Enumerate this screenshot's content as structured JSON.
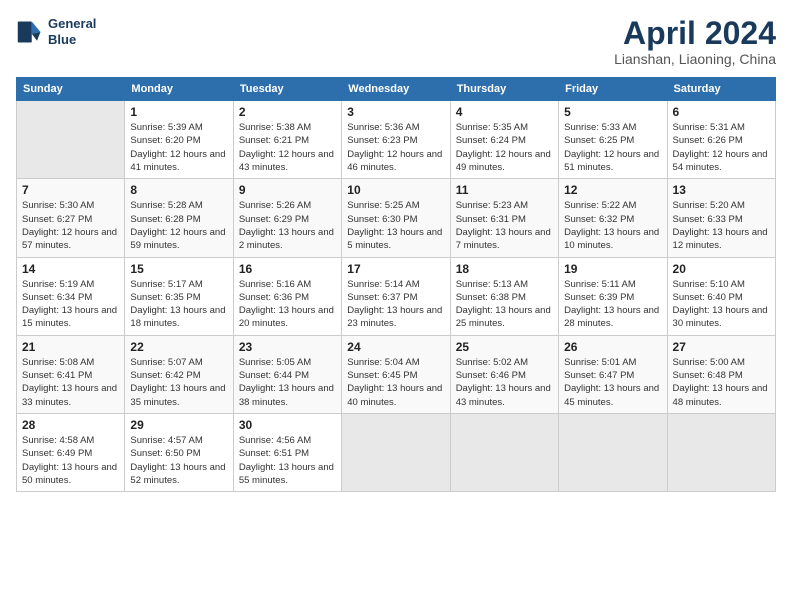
{
  "header": {
    "logo_line1": "General",
    "logo_line2": "Blue",
    "month_title": "April 2024",
    "subtitle": "Lianshan, Liaoning, China"
  },
  "days_of_week": [
    "Sunday",
    "Monday",
    "Tuesday",
    "Wednesday",
    "Thursday",
    "Friday",
    "Saturday"
  ],
  "weeks": [
    [
      {
        "day": "",
        "empty": true
      },
      {
        "day": "1",
        "sunrise": "Sunrise: 5:39 AM",
        "sunset": "Sunset: 6:20 PM",
        "daylight": "Daylight: 12 hours and 41 minutes."
      },
      {
        "day": "2",
        "sunrise": "Sunrise: 5:38 AM",
        "sunset": "Sunset: 6:21 PM",
        "daylight": "Daylight: 12 hours and 43 minutes."
      },
      {
        "day": "3",
        "sunrise": "Sunrise: 5:36 AM",
        "sunset": "Sunset: 6:23 PM",
        "daylight": "Daylight: 12 hours and 46 minutes."
      },
      {
        "day": "4",
        "sunrise": "Sunrise: 5:35 AM",
        "sunset": "Sunset: 6:24 PM",
        "daylight": "Daylight: 12 hours and 49 minutes."
      },
      {
        "day": "5",
        "sunrise": "Sunrise: 5:33 AM",
        "sunset": "Sunset: 6:25 PM",
        "daylight": "Daylight: 12 hours and 51 minutes."
      },
      {
        "day": "6",
        "sunrise": "Sunrise: 5:31 AM",
        "sunset": "Sunset: 6:26 PM",
        "daylight": "Daylight: 12 hours and 54 minutes."
      }
    ],
    [
      {
        "day": "7",
        "sunrise": "Sunrise: 5:30 AM",
        "sunset": "Sunset: 6:27 PM",
        "daylight": "Daylight: 12 hours and 57 minutes."
      },
      {
        "day": "8",
        "sunrise": "Sunrise: 5:28 AM",
        "sunset": "Sunset: 6:28 PM",
        "daylight": "Daylight: 12 hours and 59 minutes."
      },
      {
        "day": "9",
        "sunrise": "Sunrise: 5:26 AM",
        "sunset": "Sunset: 6:29 PM",
        "daylight": "Daylight: 13 hours and 2 minutes."
      },
      {
        "day": "10",
        "sunrise": "Sunrise: 5:25 AM",
        "sunset": "Sunset: 6:30 PM",
        "daylight": "Daylight: 13 hours and 5 minutes."
      },
      {
        "day": "11",
        "sunrise": "Sunrise: 5:23 AM",
        "sunset": "Sunset: 6:31 PM",
        "daylight": "Daylight: 13 hours and 7 minutes."
      },
      {
        "day": "12",
        "sunrise": "Sunrise: 5:22 AM",
        "sunset": "Sunset: 6:32 PM",
        "daylight": "Daylight: 13 hours and 10 minutes."
      },
      {
        "day": "13",
        "sunrise": "Sunrise: 5:20 AM",
        "sunset": "Sunset: 6:33 PM",
        "daylight": "Daylight: 13 hours and 12 minutes."
      }
    ],
    [
      {
        "day": "14",
        "sunrise": "Sunrise: 5:19 AM",
        "sunset": "Sunset: 6:34 PM",
        "daylight": "Daylight: 13 hours and 15 minutes."
      },
      {
        "day": "15",
        "sunrise": "Sunrise: 5:17 AM",
        "sunset": "Sunset: 6:35 PM",
        "daylight": "Daylight: 13 hours and 18 minutes."
      },
      {
        "day": "16",
        "sunrise": "Sunrise: 5:16 AM",
        "sunset": "Sunset: 6:36 PM",
        "daylight": "Daylight: 13 hours and 20 minutes."
      },
      {
        "day": "17",
        "sunrise": "Sunrise: 5:14 AM",
        "sunset": "Sunset: 6:37 PM",
        "daylight": "Daylight: 13 hours and 23 minutes."
      },
      {
        "day": "18",
        "sunrise": "Sunrise: 5:13 AM",
        "sunset": "Sunset: 6:38 PM",
        "daylight": "Daylight: 13 hours and 25 minutes."
      },
      {
        "day": "19",
        "sunrise": "Sunrise: 5:11 AM",
        "sunset": "Sunset: 6:39 PM",
        "daylight": "Daylight: 13 hours and 28 minutes."
      },
      {
        "day": "20",
        "sunrise": "Sunrise: 5:10 AM",
        "sunset": "Sunset: 6:40 PM",
        "daylight": "Daylight: 13 hours and 30 minutes."
      }
    ],
    [
      {
        "day": "21",
        "sunrise": "Sunrise: 5:08 AM",
        "sunset": "Sunset: 6:41 PM",
        "daylight": "Daylight: 13 hours and 33 minutes."
      },
      {
        "day": "22",
        "sunrise": "Sunrise: 5:07 AM",
        "sunset": "Sunset: 6:42 PM",
        "daylight": "Daylight: 13 hours and 35 minutes."
      },
      {
        "day": "23",
        "sunrise": "Sunrise: 5:05 AM",
        "sunset": "Sunset: 6:44 PM",
        "daylight": "Daylight: 13 hours and 38 minutes."
      },
      {
        "day": "24",
        "sunrise": "Sunrise: 5:04 AM",
        "sunset": "Sunset: 6:45 PM",
        "daylight": "Daylight: 13 hours and 40 minutes."
      },
      {
        "day": "25",
        "sunrise": "Sunrise: 5:02 AM",
        "sunset": "Sunset: 6:46 PM",
        "daylight": "Daylight: 13 hours and 43 minutes."
      },
      {
        "day": "26",
        "sunrise": "Sunrise: 5:01 AM",
        "sunset": "Sunset: 6:47 PM",
        "daylight": "Daylight: 13 hours and 45 minutes."
      },
      {
        "day": "27",
        "sunrise": "Sunrise: 5:00 AM",
        "sunset": "Sunset: 6:48 PM",
        "daylight": "Daylight: 13 hours and 48 minutes."
      }
    ],
    [
      {
        "day": "28",
        "sunrise": "Sunrise: 4:58 AM",
        "sunset": "Sunset: 6:49 PM",
        "daylight": "Daylight: 13 hours and 50 minutes."
      },
      {
        "day": "29",
        "sunrise": "Sunrise: 4:57 AM",
        "sunset": "Sunset: 6:50 PM",
        "daylight": "Daylight: 13 hours and 52 minutes."
      },
      {
        "day": "30",
        "sunrise": "Sunrise: 4:56 AM",
        "sunset": "Sunset: 6:51 PM",
        "daylight": "Daylight: 13 hours and 55 minutes."
      },
      {
        "day": "",
        "empty": true
      },
      {
        "day": "",
        "empty": true
      },
      {
        "day": "",
        "empty": true
      },
      {
        "day": "",
        "empty": true
      }
    ]
  ]
}
